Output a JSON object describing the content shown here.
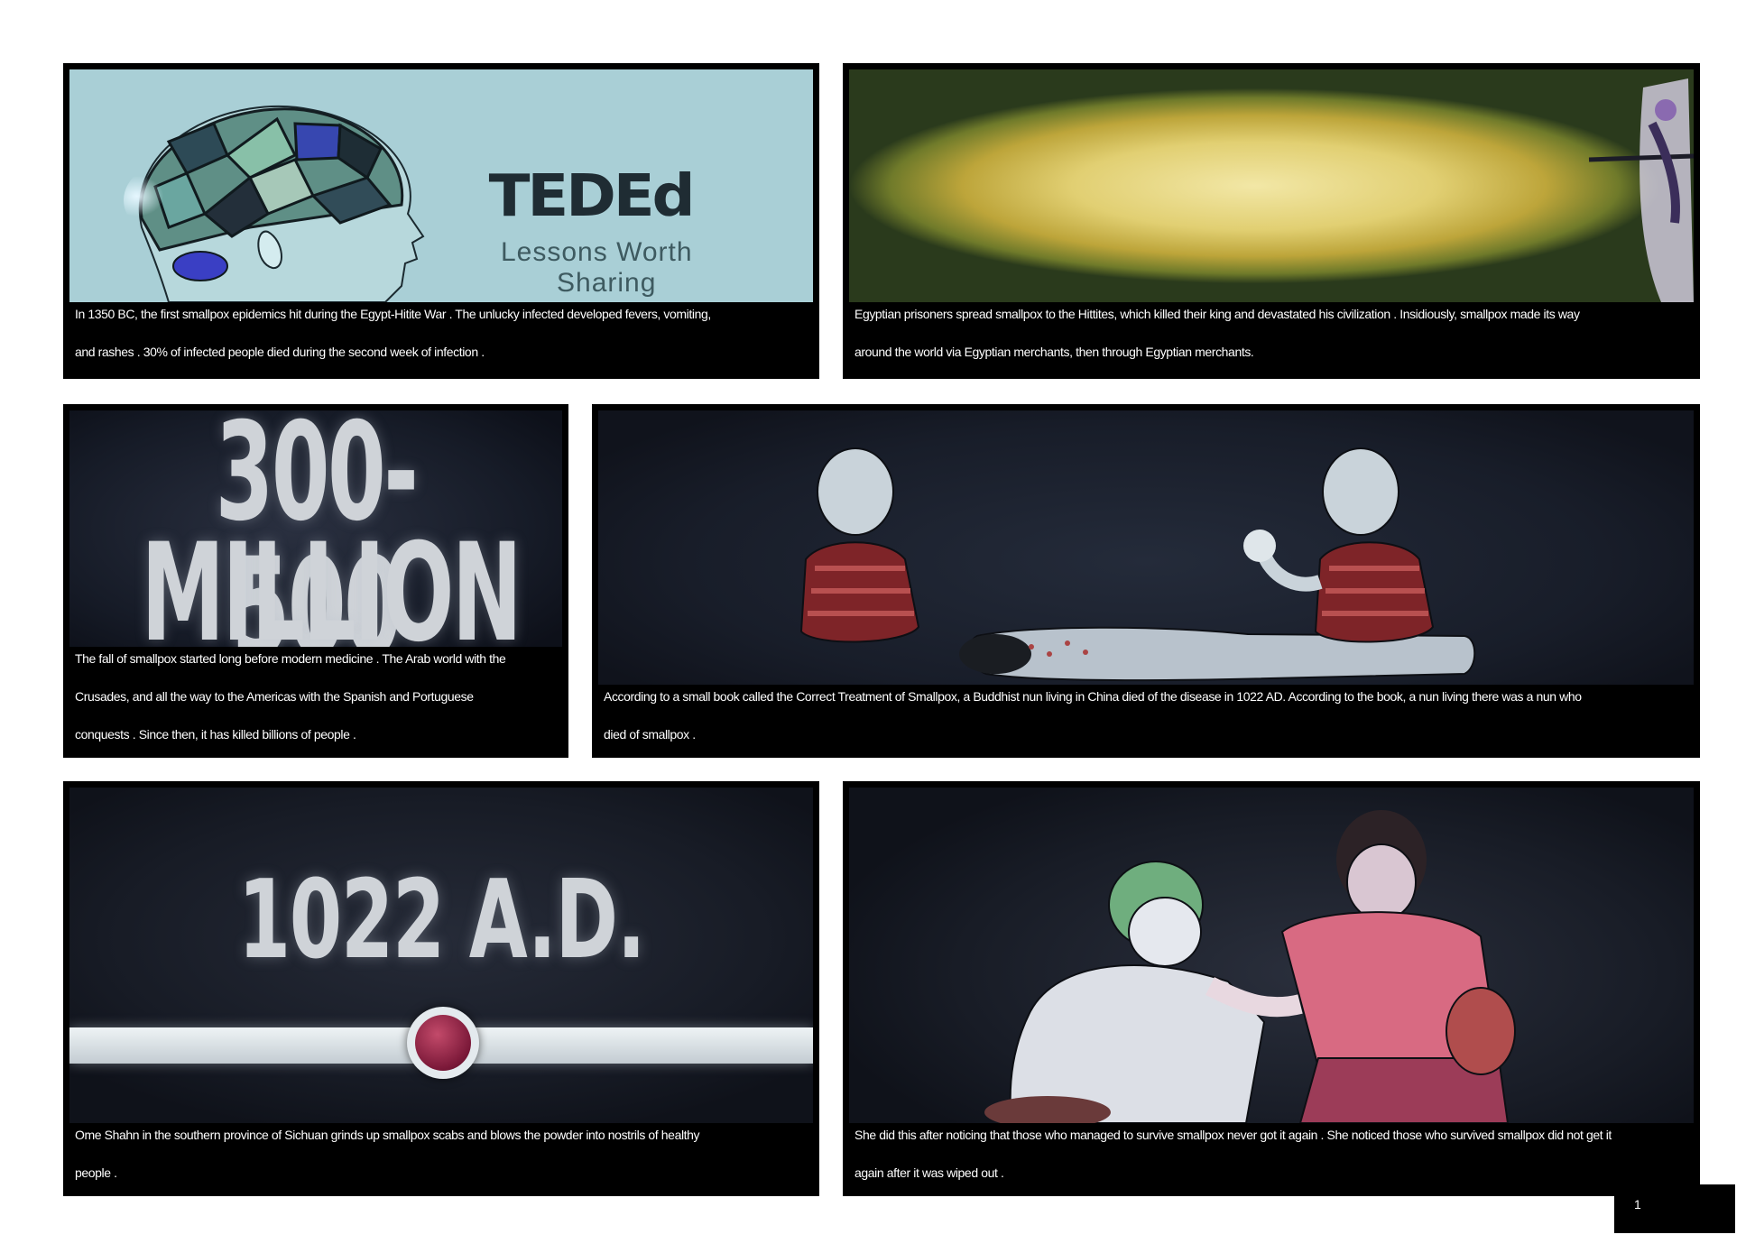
{
  "panels": [
    {
      "id": "p1",
      "image_text": {
        "logo": "TEDEd",
        "tagline_line1": "Lessons Worth",
        "tagline_line2": "Sharing"
      },
      "caption": [
        "In 1350 BC, the first smallpox epidemics hit during the Egypt-Hitite War . The unlucky infected developed fevers, vomiting,",
        "and rashes . 30% of infected people died during the second week of infection ."
      ]
    },
    {
      "id": "p2",
      "caption": [
        "Egyptian prisoners spread smallpox to the Hittites, which killed their king and devastated his civilization . Insidiously, smallpox made its way",
        "around the world via Egyptian merchants, then through Egyptian merchants."
      ]
    },
    {
      "id": "p3",
      "image_text": {
        "line1": "300-500",
        "line2": "MILLION"
      },
      "caption": [
        "The fall of smallpox started long before modern medicine . The Arab world with the",
        "Crusades, and all the way to the Americas with the Spanish and Portuguese",
        "conquests . Since then, it has killed billions of people ."
      ]
    },
    {
      "id": "p4",
      "caption": [
        "According to a small book called the Correct Treatment of Smallpox, a Buddhist nun living in China died of the disease in 1022 AD. According to the book, a nun living there was a nun who",
        "died of smallpox ."
      ]
    },
    {
      "id": "p5",
      "image_text": {
        "date": "1022 A.D."
      },
      "caption": [
        "Ome Shahn in the southern province of Sichuan grinds up smallpox scabs and blows the powder into nostrils of healthy",
        "people ."
      ]
    },
    {
      "id": "p6",
      "caption": [
        "She did this after noticing that those who managed to survive smallpox never got it again . She noticed those who survived smallpox did not get it",
        "again after it was wiped out ."
      ]
    }
  ],
  "page_number": "1"
}
